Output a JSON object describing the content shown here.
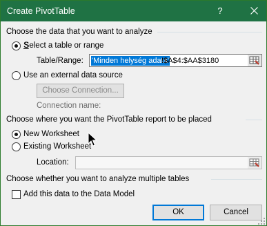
{
  "window": {
    "title": "Create PivotTable",
    "help_label": "?"
  },
  "section1": {
    "heading": "Choose the data that you want to analyze",
    "option_table_label": "Select a table or range",
    "table_range_label": "Table/Range:",
    "table_range_selected": "'Minden helység adata'",
    "table_range_rest": "!$A$4:$AA$3180",
    "option_external_label": "Use an external data source",
    "choose_connection_label": "Choose Connection...",
    "connection_name_label": "Connection name:"
  },
  "section2": {
    "heading": "Choose where you want the PivotTable report to be placed",
    "option_new_label": "New Worksheet",
    "option_existing_label": "Existing Worksheet",
    "location_label": "Location:",
    "location_value": ""
  },
  "section3": {
    "heading": "Choose whether you want to analyze multiple tables",
    "data_model_label": "Add this data to the Data Model",
    "data_model_checked": false
  },
  "buttons": {
    "ok_label": "OK",
    "cancel_label": "Cancel"
  },
  "state": {
    "selected_source": "table_range",
    "selected_destination": "new_worksheet"
  },
  "colors": {
    "titlebar": "#1f7244",
    "selection": "#0078d7",
    "separator": "#d5dfe5"
  }
}
